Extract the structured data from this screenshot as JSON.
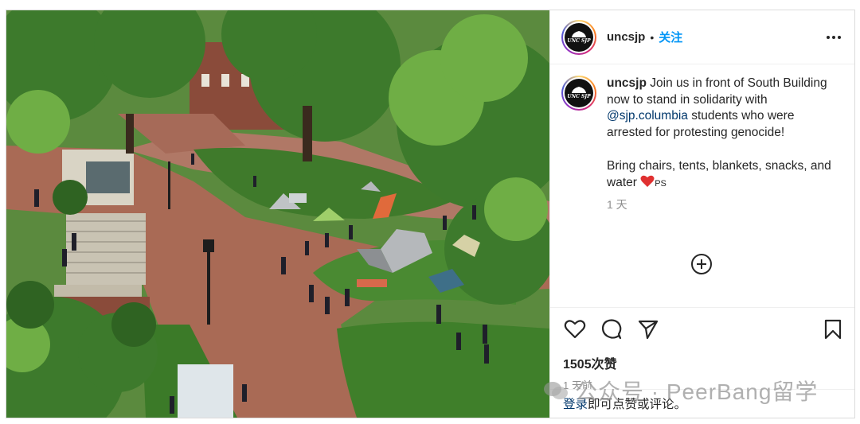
{
  "post": {
    "username": "uncsjp",
    "separator": "•",
    "follow_label": "关注",
    "avatar_text": "UNC SJP"
  },
  "caption": {
    "username": "uncsjp",
    "text_1": " Join us in front of South Building now to stand in solidarity with ",
    "mention": "@sjp.columbia",
    "text_2": " students who were arrested for protesting genocide!",
    "text_3": "Bring chairs, tents, blankets, snacks, and water ",
    "ps": "PS",
    "time": "1 天"
  },
  "actions": {
    "like_icon": "heart-outline-icon",
    "comment_icon": "comment-icon",
    "share_icon": "paper-plane-icon",
    "save_icon": "bookmark-icon",
    "add_comment_icon": "plus-circle-icon"
  },
  "likes": "1505次赞",
  "posted": "1 天前",
  "login": {
    "link": "登录",
    "rest": "即可点赞或评论。"
  },
  "watermark": "公众号 · PeerBang留学",
  "colors": {
    "follow": "#0095f6",
    "mention": "#00376b",
    "heart": "#ed4956",
    "muted": "#8e8e8e"
  }
}
